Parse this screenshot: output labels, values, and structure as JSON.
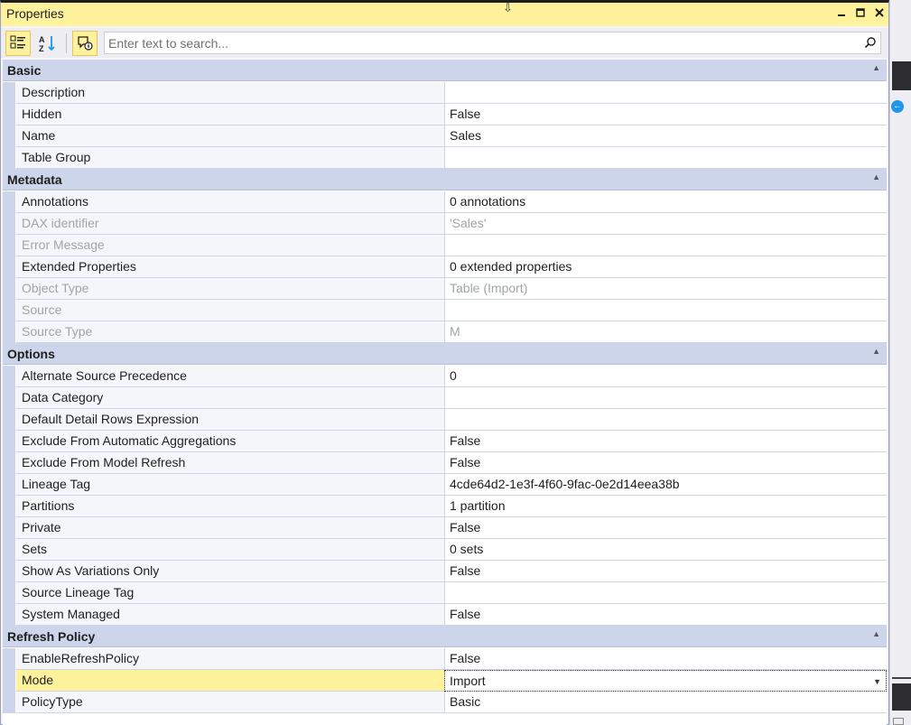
{
  "window": {
    "title": "Properties",
    "minimize_glyph": "▬",
    "maximize_glyph": "■",
    "close_glyph": "✕",
    "drag_glyph": "⇩"
  },
  "toolbar": {
    "buttons": [
      {
        "name": "categorized",
        "icon": "categorized-icon",
        "active": true
      },
      {
        "name": "alphabetical",
        "icon": "sort-az-icon",
        "active": false
      },
      {
        "name": "property-pages",
        "icon": "property-pages-icon",
        "active": false
      }
    ],
    "az_text": "AZ"
  },
  "search": {
    "placeholder": "Enter text to search...",
    "value": ""
  },
  "categories": [
    {
      "label": "Basic",
      "rows": [
        {
          "name": "Description",
          "value": "",
          "readonly": false
        },
        {
          "name": "Hidden",
          "value": "False",
          "readonly": false
        },
        {
          "name": "Name",
          "value": "Sales",
          "readonly": false
        },
        {
          "name": "Table Group",
          "value": "",
          "readonly": false
        }
      ]
    },
    {
      "label": "Metadata",
      "rows": [
        {
          "name": "Annotations",
          "value": "0 annotations",
          "readonly": false
        },
        {
          "name": "DAX identifier",
          "value": "'Sales'",
          "readonly": true
        },
        {
          "name": "Error Message",
          "value": "",
          "readonly": true
        },
        {
          "name": "Extended Properties",
          "value": "0 extended properties",
          "readonly": false
        },
        {
          "name": "Object Type",
          "value": "Table (Import)",
          "readonly": true
        },
        {
          "name": "Source",
          "value": "",
          "readonly": true
        },
        {
          "name": "Source Type",
          "value": "M",
          "readonly": true
        }
      ]
    },
    {
      "label": "Options",
      "rows": [
        {
          "name": "Alternate Source Precedence",
          "value": "0",
          "readonly": false
        },
        {
          "name": "Data Category",
          "value": "",
          "readonly": false
        },
        {
          "name": "Default Detail Rows Expression",
          "value": "",
          "readonly": false
        },
        {
          "name": "Exclude From Automatic Aggregations",
          "value": "False",
          "readonly": false
        },
        {
          "name": "Exclude From Model Refresh",
          "value": "False",
          "readonly": false
        },
        {
          "name": "Lineage Tag",
          "value": "4cde64d2-1e3f-4f60-9fac-0e2d14eea38b",
          "readonly": false
        },
        {
          "name": "Partitions",
          "value": "1 partition",
          "readonly": false
        },
        {
          "name": "Private",
          "value": "False",
          "readonly": false
        },
        {
          "name": "Sets",
          "value": "0 sets",
          "readonly": false
        },
        {
          "name": "Show As Variations Only",
          "value": "False",
          "readonly": false
        },
        {
          "name": "Source Lineage Tag",
          "value": "",
          "readonly": false
        },
        {
          "name": "System Managed",
          "value": "False",
          "readonly": false
        }
      ]
    },
    {
      "label": "Refresh Policy",
      "rows": [
        {
          "name": "EnableRefreshPolicy",
          "value": "False",
          "readonly": false
        },
        {
          "name": "Mode",
          "value": "Import",
          "readonly": false,
          "selected": true,
          "dropdown": true
        },
        {
          "name": "PolicyType",
          "value": "Basic",
          "readonly": false
        }
      ]
    }
  ],
  "colors": {
    "title_bar": "#fff29d",
    "category_bg": "#ccd5e9",
    "selected_row": "#fff29d",
    "readonly_text": "#a2a4a5"
  }
}
